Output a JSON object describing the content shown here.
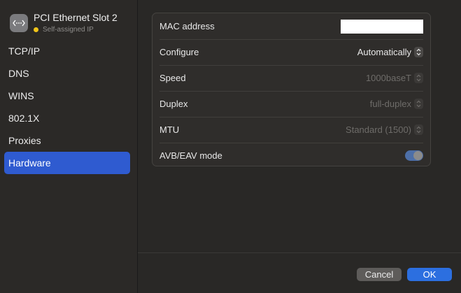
{
  "header": {
    "title": "PCI Ethernet Slot 2",
    "status": "Self-assigned IP",
    "status_color": "#f0c419",
    "icon": "network-icon"
  },
  "sidebar": {
    "items": [
      {
        "label": "TCP/IP",
        "active": false
      },
      {
        "label": "DNS",
        "active": false
      },
      {
        "label": "WINS",
        "active": false
      },
      {
        "label": "802.1X",
        "active": false
      },
      {
        "label": "Proxies",
        "active": false
      },
      {
        "label": "Hardware",
        "active": true
      }
    ],
    "accent": "#2f5bd0"
  },
  "hardware": {
    "mac": {
      "label": "MAC address",
      "value": ""
    },
    "configure": {
      "label": "Configure",
      "value": "Automatically"
    },
    "speed": {
      "label": "Speed",
      "value": "1000baseT"
    },
    "duplex": {
      "label": "Duplex",
      "value": "full-duplex"
    },
    "mtu": {
      "label": "MTU",
      "value": "Standard (1500)"
    },
    "avb": {
      "label": "AVB/EAV mode",
      "on": true
    }
  },
  "footer": {
    "cancel_label": "Cancel",
    "ok_label": "OK"
  }
}
